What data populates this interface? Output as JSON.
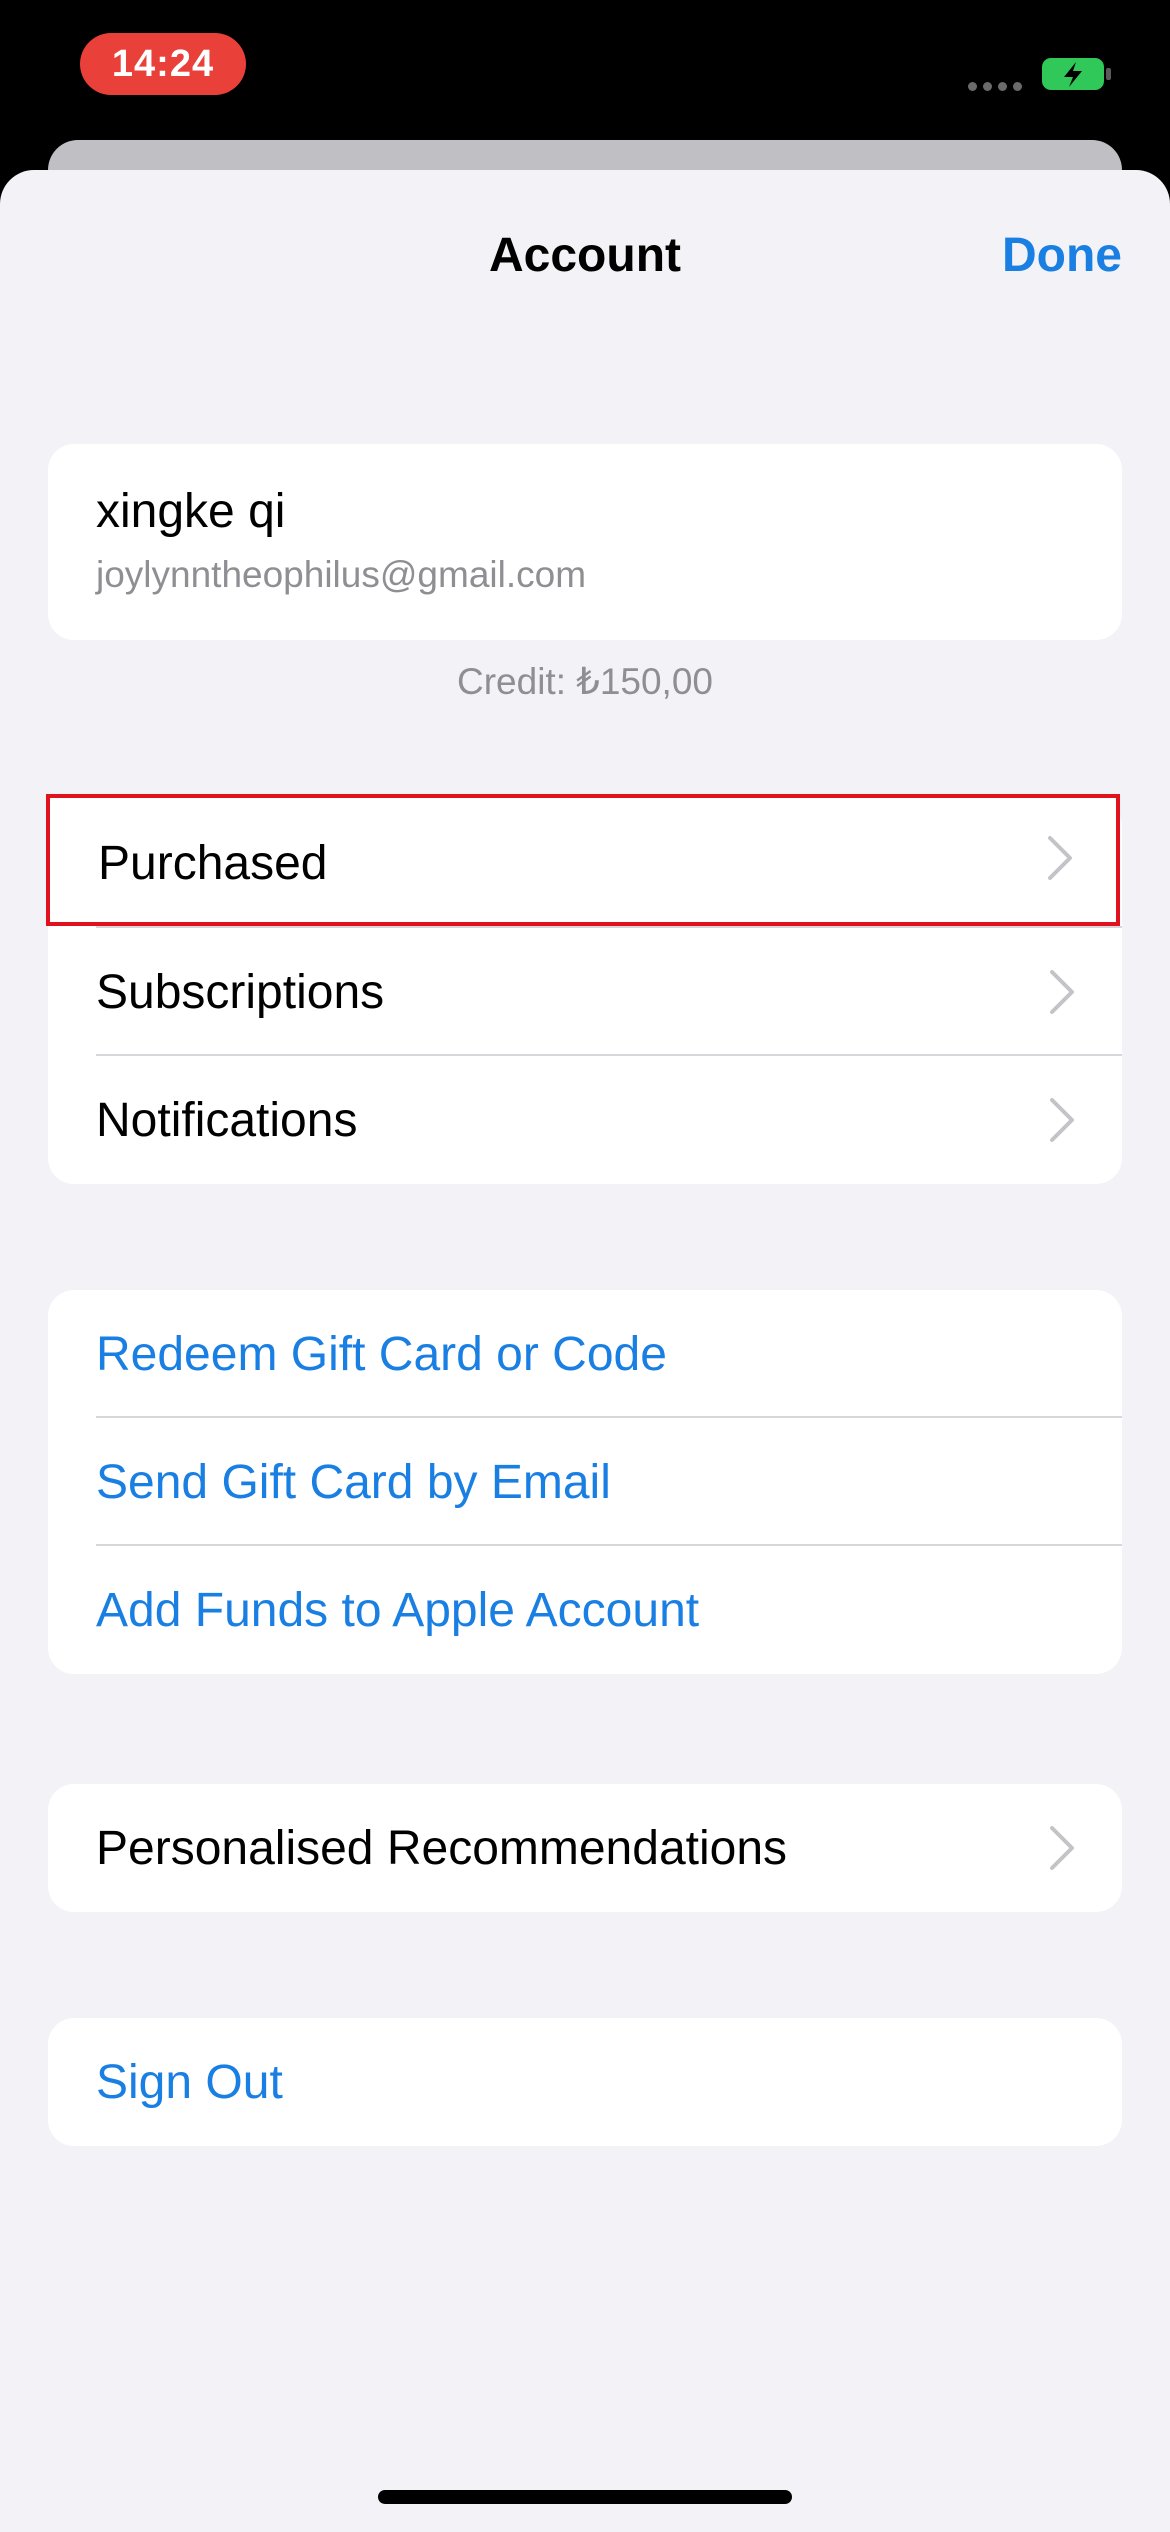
{
  "status_bar": {
    "time": "14:24",
    "colors": {
      "time_pill": "#e9403a",
      "battery": "#31c85a"
    }
  },
  "nav": {
    "title": "Account",
    "done_label": "Done"
  },
  "account": {
    "name": "xingke qi",
    "email": "joylynntheophilus@gmail.com",
    "credit": "Credit: ₺150,00"
  },
  "menu": {
    "items": [
      {
        "label": "Purchased",
        "highlighted": true
      },
      {
        "label": "Subscriptions"
      },
      {
        "label": "Notifications"
      }
    ]
  },
  "gift": {
    "items": [
      {
        "label": "Redeem Gift Card or Code"
      },
      {
        "label": "Send Gift Card by Email"
      },
      {
        "label": "Add Funds to Apple Account"
      }
    ]
  },
  "recommendations": {
    "label": "Personalised Recommendations"
  },
  "sign_out": {
    "label": "Sign Out"
  },
  "theme": {
    "accent": "#1a7fe3",
    "highlight_border": "#e0121d",
    "background": "#f2f2f7"
  }
}
